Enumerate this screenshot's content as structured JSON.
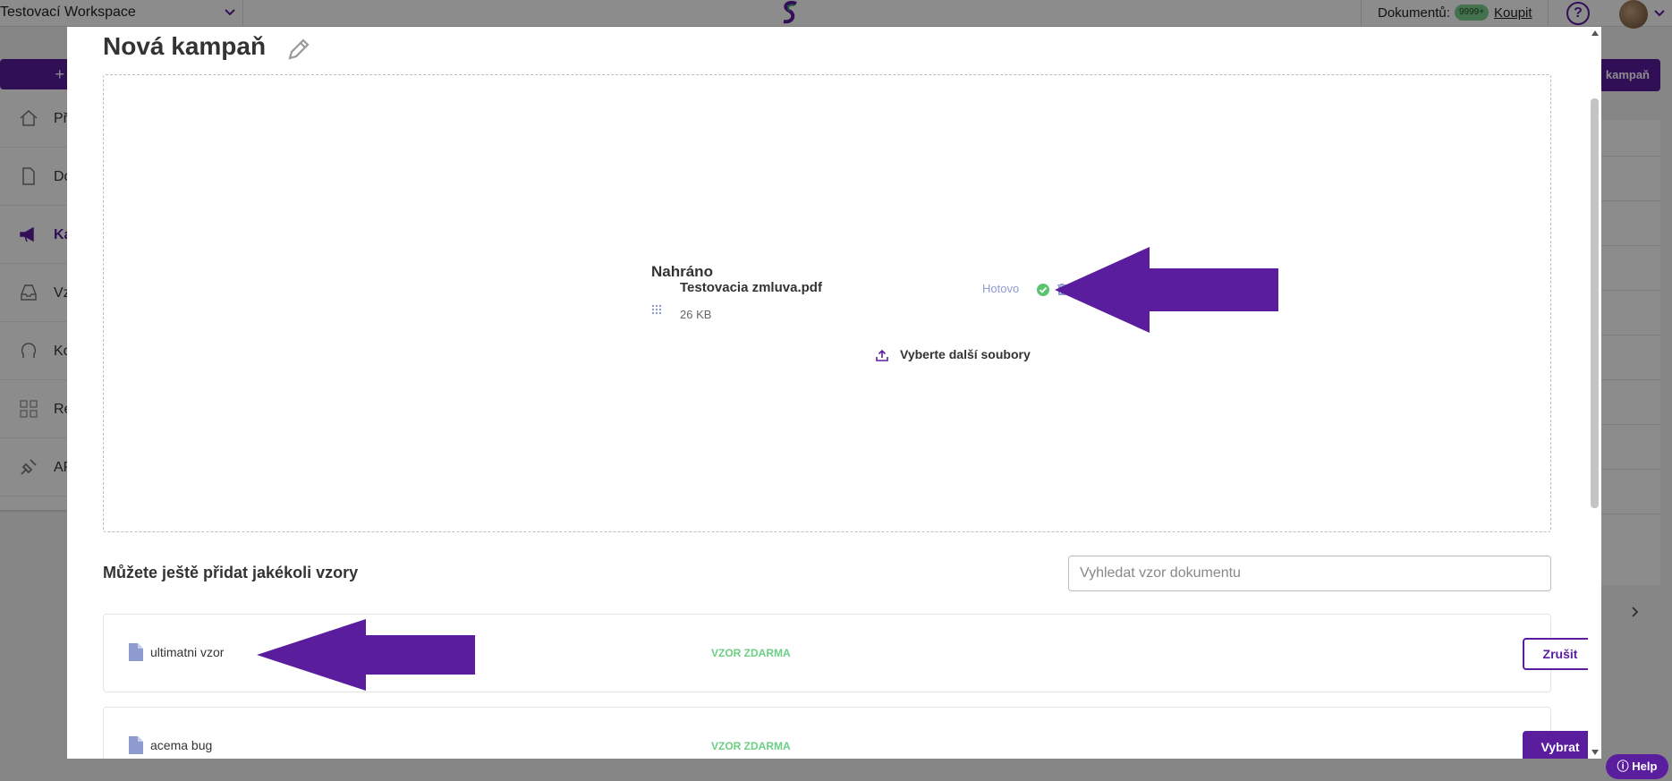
{
  "topbar": {
    "workspace": "Testovací Workspace",
    "documents_label": "Dokumentů:",
    "documents_count": "9999+",
    "buy_link": "Koupit"
  },
  "sidebar": {
    "new_button": "+",
    "items": [
      {
        "label": "Př",
        "icon": "home-icon"
      },
      {
        "label": "Do",
        "icon": "document-icon"
      },
      {
        "label": "Ka",
        "icon": "megaphone-icon"
      },
      {
        "label": "Vz",
        "icon": "inbox-icon"
      },
      {
        "label": "Ko",
        "icon": "contacts-icon"
      },
      {
        "label": "Re",
        "icon": "grid-icon"
      },
      {
        "label": "AP",
        "icon": "plug-icon"
      }
    ]
  },
  "background": {
    "right_button": "kampaň",
    "help": "Help"
  },
  "modal": {
    "title": "Nová kampaň",
    "upload": {
      "heading": "Nahráno",
      "file_name": "Testovacia zmluva.pdf",
      "file_size": "26 KB",
      "status": "Hotovo",
      "more_files": "Vyberte další soubory"
    },
    "templates": {
      "heading": "Můžete ještě přidat jakékoli vzory",
      "search_placeholder": "Vyhledat vzor dokumentu",
      "rows": [
        {
          "name": "ultimatni vzor",
          "tag": "VZOR ZDARMA",
          "action": "Zrušit"
        },
        {
          "name": "acema bug",
          "tag": "VZOR ZDARMA",
          "action": "Vybrat"
        }
      ]
    }
  },
  "colors": {
    "brand_purple": "#5a1d9e",
    "arrow_purple": "#5a1d9e",
    "free_tag_green": "#6ccf84",
    "status_blue": "#8e9ad0",
    "ok_green": "#5cc46e"
  }
}
